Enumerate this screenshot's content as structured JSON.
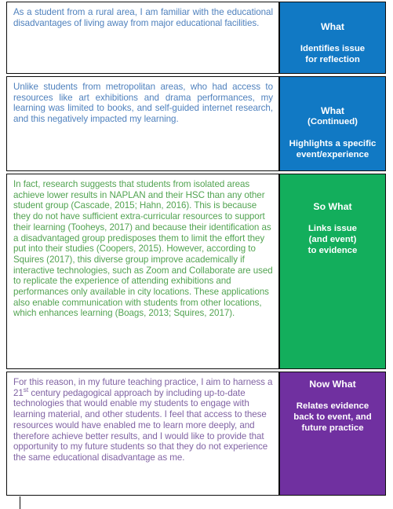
{
  "document": {
    "type": "reflective-writing-table",
    "colors": {
      "what_bg": "#1179c4",
      "so_what_bg": "#13ae5c",
      "now_what_bg": "#7030a0",
      "what_text": "#4f81bd",
      "so_what_text": "#52a351",
      "now_what_text": "#8063a3",
      "border": "#0d0d0d"
    }
  },
  "rows": [
    {
      "id": "what",
      "reflection": "As a student from a rural area, I am familiar with the educational disadvantages of living away from major educational facilities.",
      "label_heading": "What",
      "label_subtext_line1": "Identifies issue",
      "label_subtext_line2": "for reflection",
      "label_continued": ""
    },
    {
      "id": "what-continued",
      "reflection": "Unlike students from metropolitan areas, who had access to resources like art exhibitions and drama performances, my learning was limited to books, and self-guided internet research, and this negatively impacted my learning.",
      "label_heading": "What",
      "label_continued": "(Continued)",
      "label_subtext_line1": "Highlights a specific",
      "label_subtext_line2": "event/experience"
    },
    {
      "id": "so-what",
      "reflection": "In fact, research suggests that students from isolated areas achieve lower results in NAPLAN and their HSC than any other student group (Cascade, 2015; Hahn, 2016). This is because they do not have sufficient extra-curricular resources to support their learning (Tooheys, 2017) and because their identification as a disadvantaged group predisposes them to limit the effort they put into their studies (Coopers, 2015). However, according to Squires (2017), this diverse group improve academically if interactive technologies, such as Zoom and Collaborate are used to replicate the experience of attending exhibitions and performances only available in city locations. These applications also enable communication with students from other locations, which enhances learning (Boags, 2013; Squires, 2017).",
      "label_heading": "So What",
      "label_continued": "",
      "label_subtext_line1": "Links issue",
      "label_subtext_line2": "(and event)",
      "label_subtext_line3": "to evidence"
    },
    {
      "id": "now-what",
      "reflection_part1": "For this reason, in my future teaching practice, I aim to harness a 21",
      "reflection_superscript": "st",
      "reflection_part2": " century pedagogical approach by including up-to-date technologies that would enable my students to engage with learning material, and other students. I feel that access to these resources would have enabled me to learn more deeply, and therefore achieve better results, and I would like to provide that opportunity to my future students so that they do not experience the same educational disadvantage as me.",
      "label_heading": "Now What",
      "label_continued": "",
      "label_subtext_line1": "Relates evidence",
      "label_subtext_line2": "back to event, and",
      "label_subtext_line3": "future practice"
    }
  ]
}
